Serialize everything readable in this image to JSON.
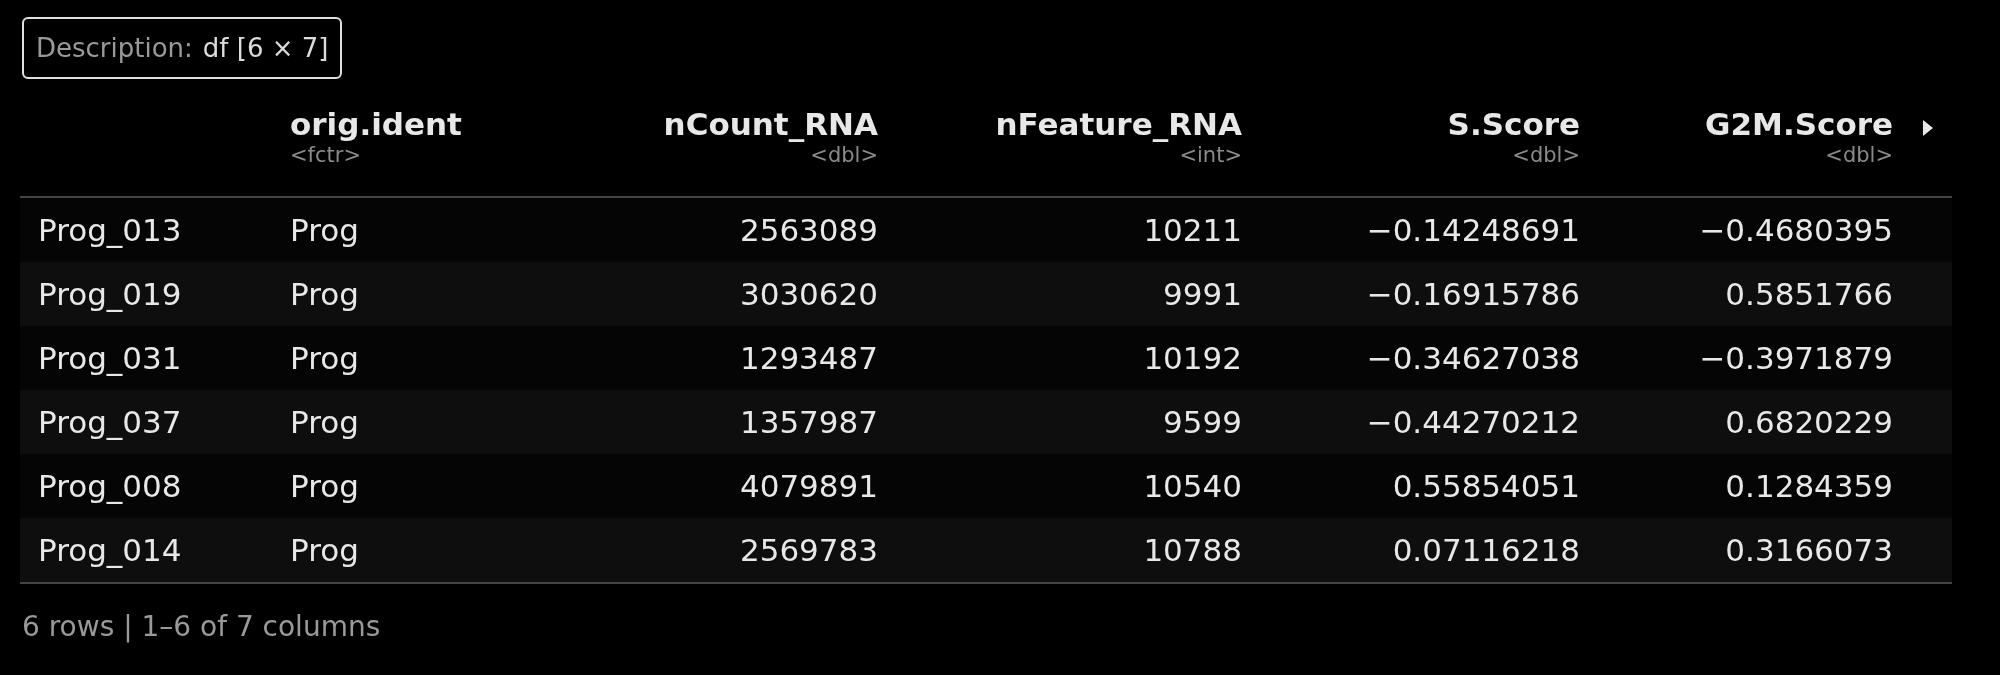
{
  "description": {
    "label": "Description:",
    "value": "df [6 × 7]"
  },
  "columns": [
    {
      "name": "orig.ident",
      "type": "<fctr>"
    },
    {
      "name": "nCount_RNA",
      "type": "<dbl>"
    },
    {
      "name": "nFeature_RNA",
      "type": "<int>"
    },
    {
      "name": "S.Score",
      "type": "<dbl>"
    },
    {
      "name": "G2M.Score",
      "type": "<dbl>"
    }
  ],
  "rows": [
    {
      "name": "Prog_013",
      "cells": [
        "Prog",
        "2563089",
        "10211",
        "−0.14248691",
        "−0.4680395"
      ]
    },
    {
      "name": "Prog_019",
      "cells": [
        "Prog",
        "3030620",
        "9991",
        "−0.16915786",
        "0.5851766"
      ]
    },
    {
      "name": "Prog_031",
      "cells": [
        "Prog",
        "1293487",
        "10192",
        "−0.34627038",
        "−0.3971879"
      ]
    },
    {
      "name": "Prog_037",
      "cells": [
        "Prog",
        "1357987",
        "9599",
        "−0.44270212",
        "0.6820229"
      ]
    },
    {
      "name": "Prog_008",
      "cells": [
        "Prog",
        "4079891",
        "10540",
        "0.55854051",
        "0.1284359"
      ]
    },
    {
      "name": "Prog_014",
      "cells": [
        "Prog",
        "2569783",
        "10788",
        "0.07116218",
        "0.3166073"
      ]
    }
  ],
  "footer": "6 rows | 1–6 of 7 columns"
}
